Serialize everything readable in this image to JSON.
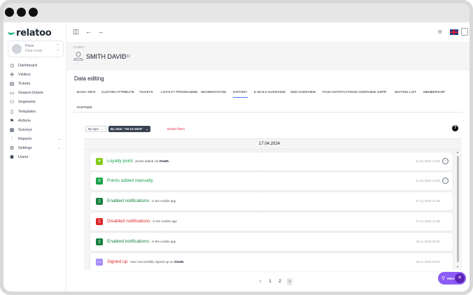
{
  "app": {
    "logo_text": "relatoo"
  },
  "place": {
    "name": "Paris",
    "mode": "Data mode"
  },
  "sidebar": {
    "items": [
      {
        "label": "Dashboard",
        "icon": "dashboard-icon",
        "glyph": "◷"
      },
      {
        "label": "Visitors",
        "icon": "visitors-icon",
        "glyph": "✣"
      },
      {
        "label": "Tickets",
        "icon": "tickets-icon",
        "glyph": "▤"
      },
      {
        "label": "Season tickets",
        "icon": "season-tickets-icon",
        "glyph": "▭"
      },
      {
        "label": "Segments",
        "icon": "segments-icon",
        "glyph": "⚇"
      },
      {
        "label": "Templates",
        "icon": "templates-icon",
        "glyph": "▯"
      },
      {
        "label": "Actions",
        "icon": "actions-icon",
        "glyph": "⚑"
      },
      {
        "label": "Surveys",
        "icon": "surveys-icon",
        "glyph": "▦"
      },
      {
        "label": "Reports",
        "icon": "reports-icon",
        "glyph": "⫶",
        "chevron": "⌄"
      },
      {
        "label": "Settings",
        "icon": "settings-icon",
        "glyph": "⚙",
        "chevron": "⌄"
      },
      {
        "label": "Users",
        "icon": "users-icon",
        "glyph": "⚉"
      }
    ]
  },
  "client": {
    "label": "CLIENT",
    "name": "SMITH DAVID",
    "id": "- #102"
  },
  "editing": {
    "title": "Data editing",
    "tabs": [
      "Basic info",
      "Custom attribute",
      "Tickets",
      "Loyalty programme",
      "Segmentation",
      "History",
      "E-mails overview",
      "SMS overview",
      "Push notifications overview",
      "GDPR",
      "Waiting list",
      "Membership",
      "Partner"
    ],
    "active_tab": "History",
    "filter_type": "By type",
    "filter_date": "By date: \"20-12-2023\"",
    "delete_filters": "Delete filters"
  },
  "history": {
    "date": "17.04.2024",
    "items": [
      {
        "title": "Loyalty point",
        "desc_pre": " - points added via ",
        "desc_bold": "OneID.",
        "time": "11.01.2024 13:33",
        "color": "#16a34a",
        "icon_bg": "#84cc16",
        "icon": "star-icon",
        "glyph": "✦",
        "has_more": true
      },
      {
        "title": "Points added manually",
        "desc_pre": "",
        "desc_bold": "",
        "time": "11.01.2024 13:33",
        "color": "#16a34a",
        "icon_bg": "#16a34a",
        "icon": "points-icon",
        "glyph": "⊙",
        "has_more": true
      },
      {
        "title": "Enabled notifications",
        "desc_pre": " - in the mobile app",
        "desc_bold": "",
        "time": "27.11.2023 12:36",
        "color": "#15803d",
        "icon_bg": "#15803d",
        "icon": "phone-icon",
        "glyph": "▯",
        "has_more": false
      },
      {
        "title": "Disabled notifications",
        "desc_pre": " - in the mobile app",
        "desc_bold": "",
        "time": "27.11.2023 12:36",
        "color": "#dc2626",
        "icon_bg": "#dc2626",
        "icon": "phone-icon",
        "glyph": "▯",
        "has_more": false
      },
      {
        "title": "Enabled notifications",
        "desc_pre": " - in the mobile app",
        "desc_bold": "",
        "time": "15.11.2023 09:37",
        "color": "#15803d",
        "icon_bg": "#15803d",
        "icon": "phone-icon",
        "glyph": "▯",
        "has_more": false
      },
      {
        "title": "Signed up",
        "desc_pre": " - user successfully signed up on ",
        "desc_bold": "OneID.",
        "time": "15.11.2023 09:37",
        "color": "#dc2626",
        "icon_bg": "#a78bfa",
        "icon": "signup-icon",
        "glyph": "▭",
        "has_more": false
      }
    ]
  },
  "pagination": {
    "prev": "‹",
    "pages": [
      "1",
      "2"
    ],
    "next": "›"
  },
  "help": {
    "label": "HELP",
    "close": "✕"
  }
}
